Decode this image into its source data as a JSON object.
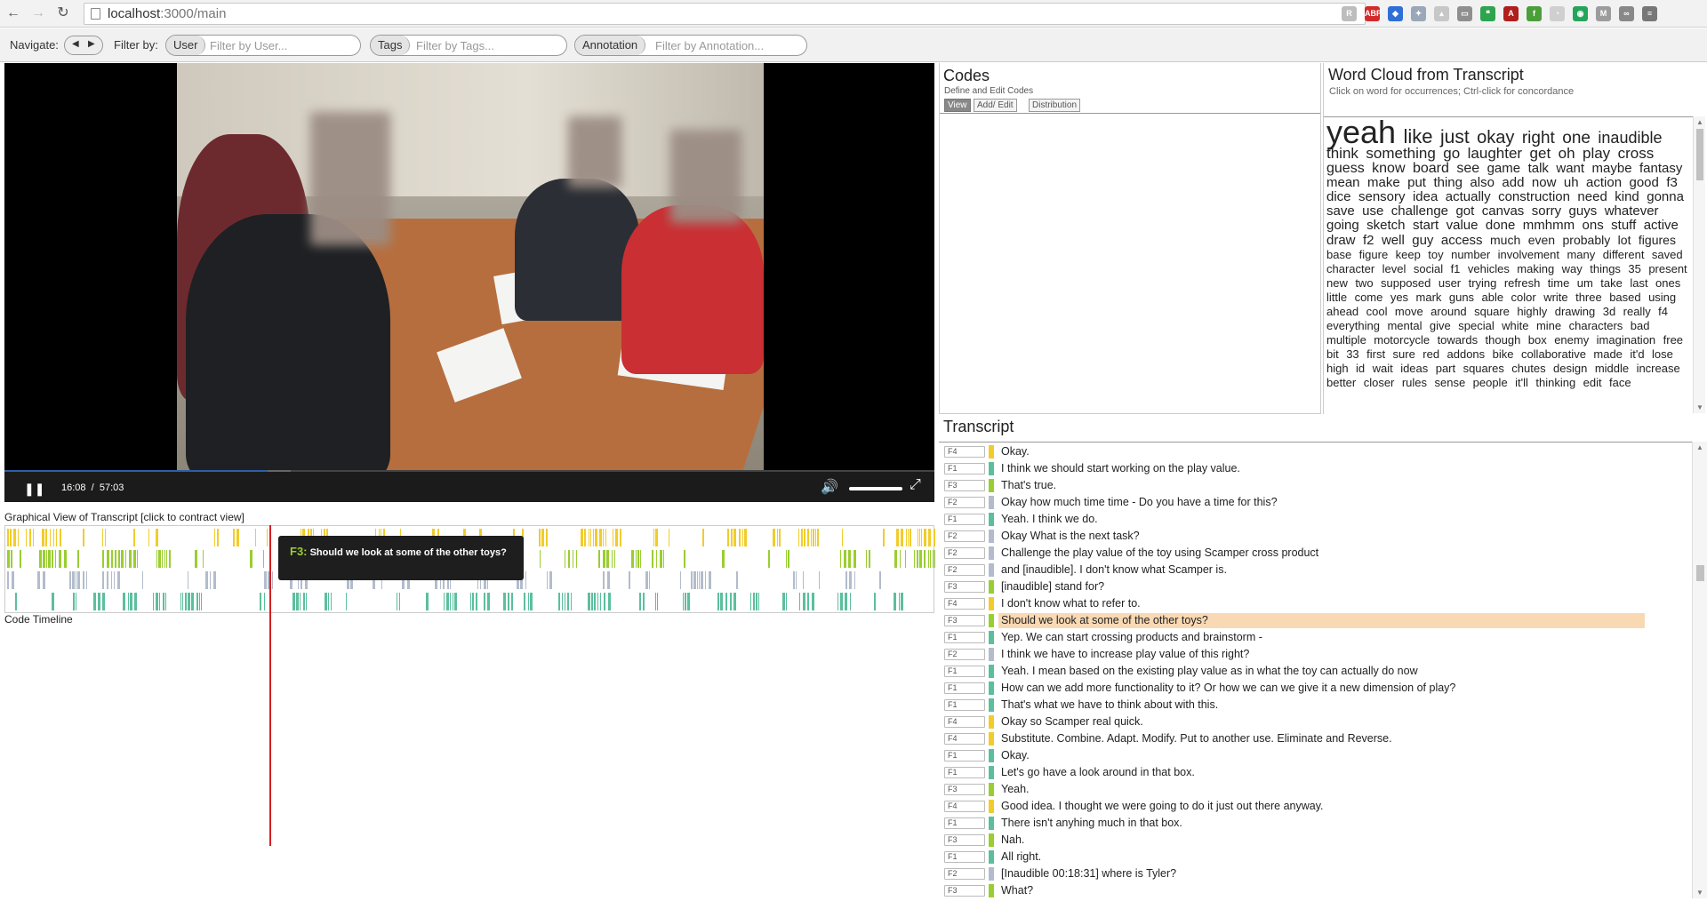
{
  "browser": {
    "url_host": "localhost",
    "url_path": ":3000/main",
    "extensions": [
      {
        "name": "r-icon",
        "label": "R",
        "color": "#bdbdbd"
      },
      {
        "name": "adblock-icon",
        "label": "ABP",
        "color": "#d32b2b"
      },
      {
        "name": "dropbox-icon",
        "label": "◆",
        "color": "#2f6fd6"
      },
      {
        "name": "dropbox-alt-icon",
        "label": "✦",
        "color": "#9aa7b8"
      },
      {
        "name": "chart-icon",
        "label": "▴",
        "color": "#c7c7c7"
      },
      {
        "name": "keyboard-icon",
        "label": "▭",
        "color": "#8f8f8f"
      },
      {
        "name": "hangouts-icon",
        "label": "❝",
        "color": "#2ea44f"
      },
      {
        "name": "pdf-icon",
        "label": "A",
        "color": "#b01e1e"
      },
      {
        "name": "feedly-icon",
        "label": "f",
        "color": "#4b9f3a"
      },
      {
        "name": "clock-icon",
        "label": "◔",
        "color": "#cfcfcf"
      },
      {
        "name": "pushbullet-icon",
        "label": "◉",
        "color": "#25a55b"
      },
      {
        "name": "mendeley-icon",
        "label": "M",
        "color": "#9c9c9c"
      },
      {
        "name": "link-icon",
        "label": "∞",
        "color": "#888888"
      },
      {
        "name": "menu-icon",
        "label": "≡",
        "color": "#777777"
      }
    ]
  },
  "toolbar": {
    "navigate_label": "Navigate:",
    "filter_label": "Filter by:",
    "user_pill": "User",
    "user_placeholder": "Filter by User...",
    "tags_pill": "Tags",
    "tags_placeholder": "Filter by Tags...",
    "annotation_pill": "Annotation",
    "annotation_placeholder": "Filter by Annotation..."
  },
  "video": {
    "current_time": "16:08",
    "separator": "/",
    "duration": "57:03",
    "progress": 0.283,
    "buffered": 0.308
  },
  "graphical_view": {
    "title": "Graphical View of Transcript [click to contract view]",
    "tooltip_speaker": "F3:",
    "tooltip_text": "Should we look at some of the other toys?",
    "code_timeline_label": "Code Timeline",
    "track_colors": [
      "#f2cc2a",
      "#9acd32",
      "#b2bccc",
      "#5bbf9e"
    ]
  },
  "codes": {
    "title": "Codes",
    "subtitle": "Define and Edit Codes",
    "tabs": [
      "View",
      "Add/ Edit",
      "Distribution"
    ]
  },
  "wordcloud": {
    "title": "Word Cloud from Transcript",
    "subtitle": "Click on word for occurrences; Ctrl-click for concordance",
    "words": [
      {
        "t": "yeah",
        "s": 36
      },
      {
        "t": "like",
        "s": 22
      },
      {
        "t": "just",
        "s": 21
      },
      {
        "t": "okay",
        "s": 20
      },
      {
        "t": "right",
        "s": 19
      },
      {
        "t": "one",
        "s": 19
      },
      {
        "t": "inaudible",
        "s": 18
      },
      {
        "t": "think",
        "s": 17
      },
      {
        "t": "something",
        "s": 17
      },
      {
        "t": "go",
        "s": 17
      },
      {
        "t": "laughter",
        "s": 17
      },
      {
        "t": "get",
        "s": 17
      },
      {
        "t": "oh",
        "s": 17
      },
      {
        "t": "play",
        "s": 17
      },
      {
        "t": "cross",
        "s": 17
      },
      {
        "t": "guess",
        "s": 16
      },
      {
        "t": "know",
        "s": 16
      },
      {
        "t": "board",
        "s": 16
      },
      {
        "t": "see",
        "s": 16
      },
      {
        "t": "game",
        "s": 15
      },
      {
        "t": "talk",
        "s": 15
      },
      {
        "t": "want",
        "s": 15
      },
      {
        "t": "maybe",
        "s": 15
      },
      {
        "t": "fantasy",
        "s": 15
      },
      {
        "t": "mean",
        "s": 15
      },
      {
        "t": "make",
        "s": 15
      },
      {
        "t": "put",
        "s": 15
      },
      {
        "t": "thing",
        "s": 15
      },
      {
        "t": "also",
        "s": 15
      },
      {
        "t": "add",
        "s": 15
      },
      {
        "t": "now",
        "s": 15
      },
      {
        "t": "uh",
        "s": 15
      },
      {
        "t": "action",
        "s": 15
      },
      {
        "t": "good",
        "s": 15
      },
      {
        "t": "f3",
        "s": 15
      },
      {
        "t": "dice",
        "s": 15
      },
      {
        "t": "sensory",
        "s": 15
      },
      {
        "t": "idea",
        "s": 15
      },
      {
        "t": "actually",
        "s": 15
      },
      {
        "t": "construction",
        "s": 15
      },
      {
        "t": "need",
        "s": 15
      },
      {
        "t": "kind",
        "s": 15
      },
      {
        "t": "gonna",
        "s": 15
      },
      {
        "t": "save",
        "s": 15
      },
      {
        "t": "use",
        "s": 15
      },
      {
        "t": "challenge",
        "s": 15
      },
      {
        "t": "got",
        "s": 15
      },
      {
        "t": "canvas",
        "s": 15
      },
      {
        "t": "sorry",
        "s": 15
      },
      {
        "t": "guys",
        "s": 15
      },
      {
        "t": "whatever",
        "s": 15
      },
      {
        "t": "going",
        "s": 15
      },
      {
        "t": "sketch",
        "s": 15
      },
      {
        "t": "start",
        "s": 15
      },
      {
        "t": "value",
        "s": 15
      },
      {
        "t": "done",
        "s": 15
      },
      {
        "t": "mmhmm",
        "s": 15
      },
      {
        "t": "ons",
        "s": 15
      },
      {
        "t": "stuff",
        "s": 15
      },
      {
        "t": "active",
        "s": 15
      },
      {
        "t": "draw",
        "s": 15
      },
      {
        "t": "f2",
        "s": 15
      },
      {
        "t": "well",
        "s": 15
      },
      {
        "t": "guy",
        "s": 15
      },
      {
        "t": "access",
        "s": 15
      },
      {
        "t": "much",
        "s": 14
      },
      {
        "t": "even",
        "s": 14
      },
      {
        "t": "probably",
        "s": 14
      },
      {
        "t": "lot",
        "s": 14
      },
      {
        "t": "figures",
        "s": 14
      },
      {
        "t": "base",
        "s": 13
      },
      {
        "t": "figure",
        "s": 13
      },
      {
        "t": "keep",
        "s": 13
      },
      {
        "t": "toy",
        "s": 13
      },
      {
        "t": "number",
        "s": 13
      },
      {
        "t": "involvement",
        "s": 13
      },
      {
        "t": "many",
        "s": 13
      },
      {
        "t": "different",
        "s": 13
      },
      {
        "t": "saved",
        "s": 13
      },
      {
        "t": "character",
        "s": 13
      },
      {
        "t": "level",
        "s": 13
      },
      {
        "t": "social",
        "s": 13
      },
      {
        "t": "f1",
        "s": 13
      },
      {
        "t": "vehicles",
        "s": 13
      },
      {
        "t": "making",
        "s": 13
      },
      {
        "t": "way",
        "s": 13
      },
      {
        "t": "things",
        "s": 13
      },
      {
        "t": "35",
        "s": 13
      },
      {
        "t": "present",
        "s": 13
      },
      {
        "t": "new",
        "s": 13
      },
      {
        "t": "two",
        "s": 13
      },
      {
        "t": "supposed",
        "s": 13
      },
      {
        "t": "user",
        "s": 13
      },
      {
        "t": "trying",
        "s": 13
      },
      {
        "t": "refresh",
        "s": 13
      },
      {
        "t": "time",
        "s": 13
      },
      {
        "t": "um",
        "s": 13
      },
      {
        "t": "take",
        "s": 13
      },
      {
        "t": "last",
        "s": 13
      },
      {
        "t": "ones",
        "s": 13
      },
      {
        "t": "little",
        "s": 13
      },
      {
        "t": "come",
        "s": 13
      },
      {
        "t": "yes",
        "s": 13
      },
      {
        "t": "mark",
        "s": 13
      },
      {
        "t": "guns",
        "s": 13
      },
      {
        "t": "able",
        "s": 13
      },
      {
        "t": "color",
        "s": 13
      },
      {
        "t": "write",
        "s": 13
      },
      {
        "t": "three",
        "s": 13
      },
      {
        "t": "based",
        "s": 13
      },
      {
        "t": "using",
        "s": 13
      },
      {
        "t": "ahead",
        "s": 13
      },
      {
        "t": "cool",
        "s": 13
      },
      {
        "t": "move",
        "s": 13
      },
      {
        "t": "around",
        "s": 13
      },
      {
        "t": "square",
        "s": 13
      },
      {
        "t": "highly",
        "s": 13
      },
      {
        "t": "drawing",
        "s": 13
      },
      {
        "t": "3d",
        "s": 13
      },
      {
        "t": "really",
        "s": 13
      },
      {
        "t": "f4",
        "s": 13
      },
      {
        "t": "everything",
        "s": 13
      },
      {
        "t": "mental",
        "s": 13
      },
      {
        "t": "give",
        "s": 13
      },
      {
        "t": "special",
        "s": 13
      },
      {
        "t": "white",
        "s": 13
      },
      {
        "t": "mine",
        "s": 13
      },
      {
        "t": "characters",
        "s": 13
      },
      {
        "t": "bad",
        "s": 13
      },
      {
        "t": "multiple",
        "s": 13
      },
      {
        "t": "motorcycle",
        "s": 13
      },
      {
        "t": "towards",
        "s": 13
      },
      {
        "t": "though",
        "s": 13
      },
      {
        "t": "box",
        "s": 13
      },
      {
        "t": "enemy",
        "s": 13
      },
      {
        "t": "imagination",
        "s": 13
      },
      {
        "t": "free",
        "s": 13
      },
      {
        "t": "bit",
        "s": 13
      },
      {
        "t": "33",
        "s": 13
      },
      {
        "t": "first",
        "s": 13
      },
      {
        "t": "sure",
        "s": 13
      },
      {
        "t": "red",
        "s": 13
      },
      {
        "t": "addons",
        "s": 13
      },
      {
        "t": "bike",
        "s": 13
      },
      {
        "t": "collaborative",
        "s": 13
      },
      {
        "t": "made",
        "s": 13
      },
      {
        "t": "it'd",
        "s": 13
      },
      {
        "t": "lose",
        "s": 13
      },
      {
        "t": "high",
        "s": 13
      },
      {
        "t": "id",
        "s": 13
      },
      {
        "t": "wait",
        "s": 13
      },
      {
        "t": "ideas",
        "s": 13
      },
      {
        "t": "part",
        "s": 13
      },
      {
        "t": "squares",
        "s": 13
      },
      {
        "t": "chutes",
        "s": 13
      },
      {
        "t": "design",
        "s": 13
      },
      {
        "t": "middle",
        "s": 13
      },
      {
        "t": "increase",
        "s": 13
      },
      {
        "t": "better",
        "s": 13
      },
      {
        "t": "closer",
        "s": 13
      },
      {
        "t": "rules",
        "s": 13
      },
      {
        "t": "sense",
        "s": 13
      },
      {
        "t": "people",
        "s": 13
      },
      {
        "t": "it'll",
        "s": 13
      },
      {
        "t": "thinking",
        "s": 13
      },
      {
        "t": "edit",
        "s": 13
      },
      {
        "t": "face",
        "s": 13
      }
    ]
  },
  "transcript": {
    "title": "Transcript",
    "rows": [
      {
        "sp": "F4",
        "c": "#f2cc2a",
        "t": "Okay."
      },
      {
        "sp": "F1",
        "c": "#5bbf9e",
        "t": "I think we should start working on the play value."
      },
      {
        "sp": "F3",
        "c": "#9acd32",
        "t": "That's true."
      },
      {
        "sp": "F2",
        "c": "#b2bccc",
        "t": "Okay how much time time - Do you have a time for this?"
      },
      {
        "sp": "F1",
        "c": "#5bbf9e",
        "t": "Yeah. I think we do."
      },
      {
        "sp": "F2",
        "c": "#b2bccc",
        "t": "Okay What is the next task?"
      },
      {
        "sp": "F2",
        "c": "#b2bccc",
        "t": "Challenge the play value of the toy using Scamper cross product"
      },
      {
        "sp": "F2",
        "c": "#b2bccc",
        "t": "and [inaudible]. I don't know what Scamper is."
      },
      {
        "sp": "F3",
        "c": "#9acd32",
        "t": "[inaudible] stand for?"
      },
      {
        "sp": "F4",
        "c": "#f2cc2a",
        "t": "I don't know what to refer to."
      },
      {
        "sp": "F3",
        "c": "#9acd32",
        "t": "Should we look at some of the other toys?",
        "hl": true
      },
      {
        "sp": "F1",
        "c": "#5bbf9e",
        "t": "Yep. We can start crossing products and brainstorm -"
      },
      {
        "sp": "F2",
        "c": "#b2bccc",
        "t": "I think we have to increase play value of this right?"
      },
      {
        "sp": "F1",
        "c": "#5bbf9e",
        "t": "Yeah. I mean based on the existing play value as in what the toy can actually do now"
      },
      {
        "sp": "F1",
        "c": "#5bbf9e",
        "t": "How can we add more functionality to it? Or how we can we give it a new dimension of play?"
      },
      {
        "sp": "F1",
        "c": "#5bbf9e",
        "t": "That's what we have to think about with this."
      },
      {
        "sp": "F4",
        "c": "#f2cc2a",
        "t": "Okay so Scamper real quick."
      },
      {
        "sp": "F4",
        "c": "#f2cc2a",
        "t": "Substitute. Combine. Adapt. Modify. Put to another use. Eliminate and Reverse."
      },
      {
        "sp": "F1",
        "c": "#5bbf9e",
        "t": "Okay."
      },
      {
        "sp": "F1",
        "c": "#5bbf9e",
        "t": "Let's go have a look around in that box."
      },
      {
        "sp": "F3",
        "c": "#9acd32",
        "t": "Yeah."
      },
      {
        "sp": "F4",
        "c": "#f2cc2a",
        "t": "Good idea. I thought we were going to do it just out there anyway."
      },
      {
        "sp": "F1",
        "c": "#5bbf9e",
        "t": "There isn't anyhing much in that box."
      },
      {
        "sp": "F3",
        "c": "#9acd32",
        "t": "Nah."
      },
      {
        "sp": "F1",
        "c": "#5bbf9e",
        "t": "All right."
      },
      {
        "sp": "F2",
        "c": "#b2bccc",
        "t": "[Inaudible 00:18:31] where is Tyler?"
      },
      {
        "sp": "F3",
        "c": "#9acd32",
        "t": "What?"
      }
    ]
  }
}
